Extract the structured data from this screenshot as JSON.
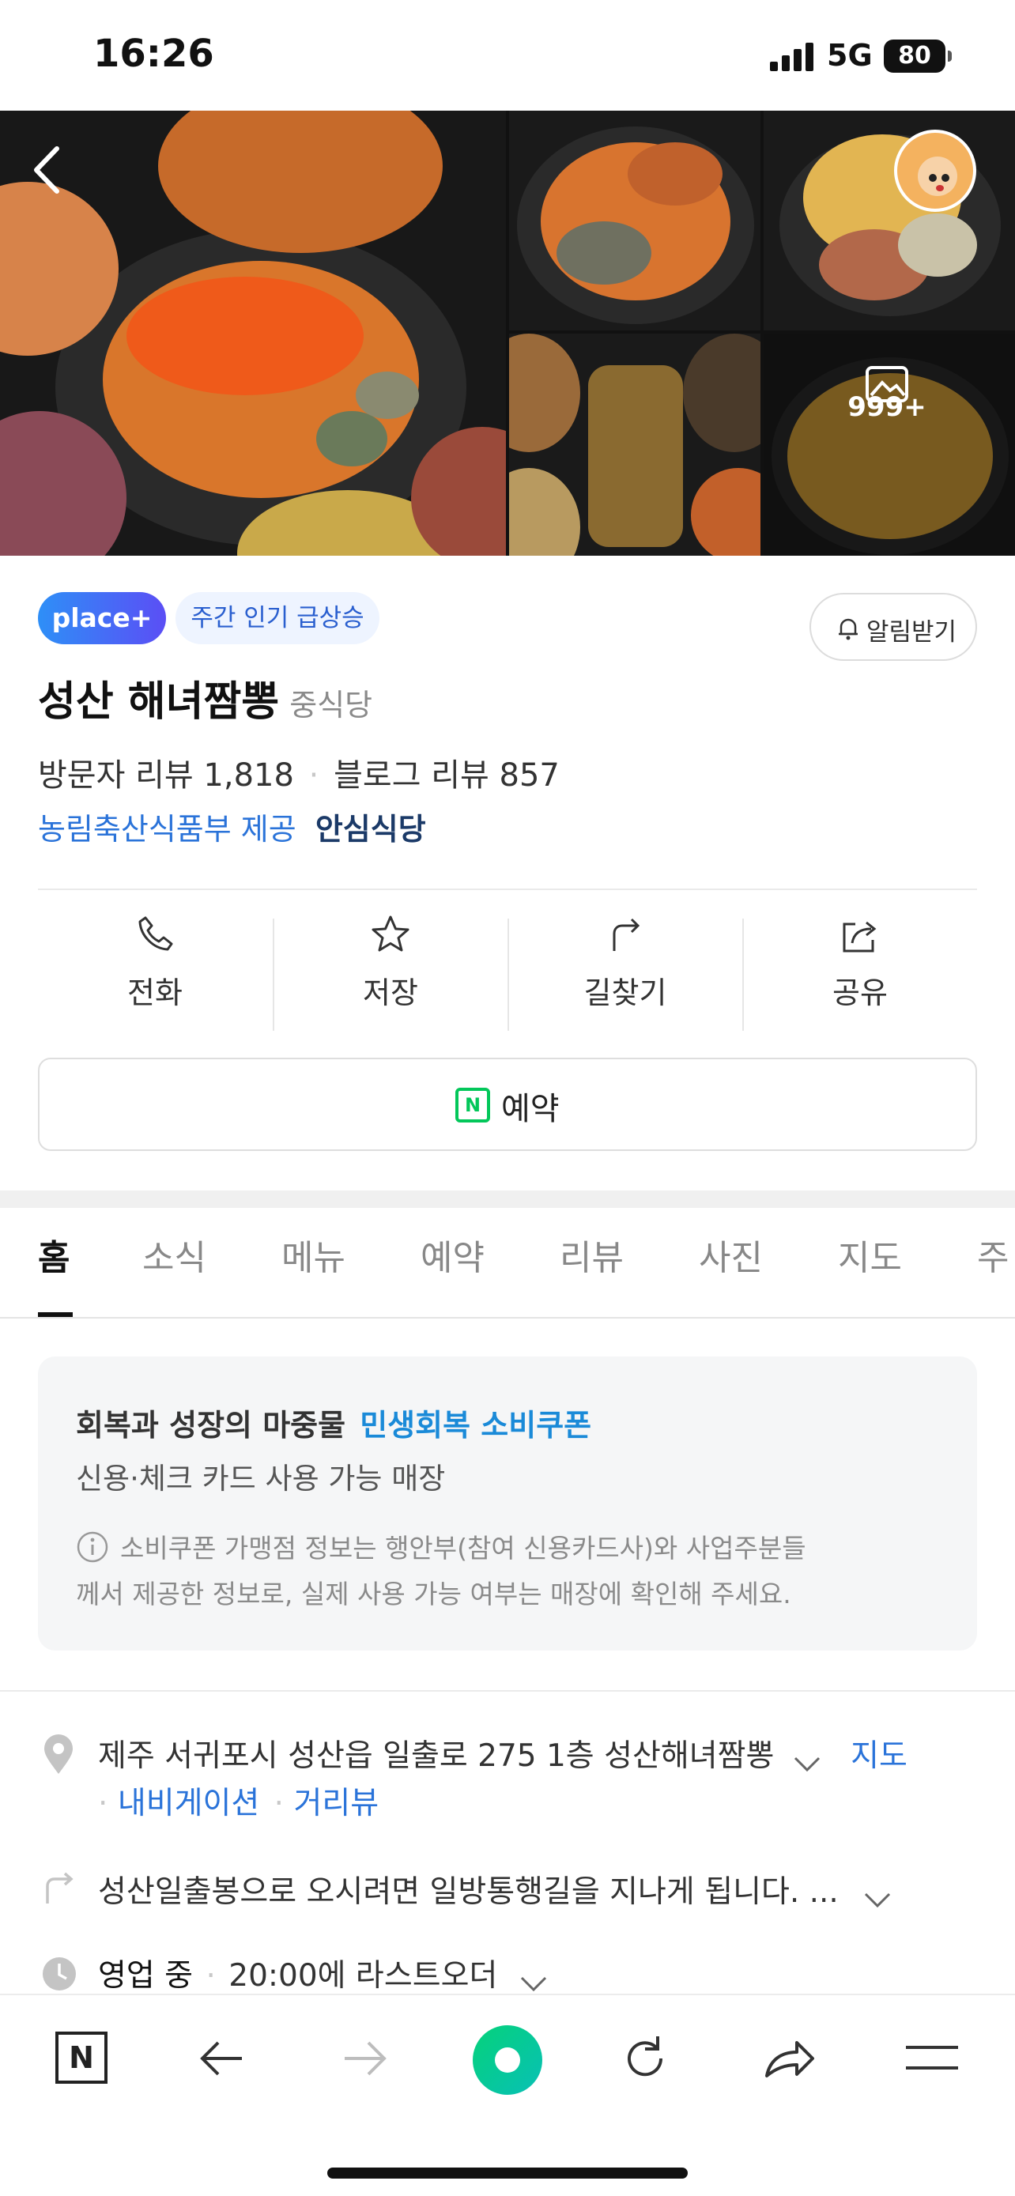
{
  "status": {
    "time": "16:26",
    "network": "5G",
    "battery": "80"
  },
  "gallery": {
    "photo_count": "999+"
  },
  "badges": {
    "place_plus": "place+",
    "trend": "주간 인기 급상승"
  },
  "notify_button": "알림받기",
  "place": {
    "name": "성산 해녀짬뽕",
    "category": "중식당"
  },
  "reviews": {
    "visitor": "방문자 리뷰 1,818",
    "blog": "블로그 리뷰 857"
  },
  "safe": {
    "provider": "농림축산식품부 제공",
    "label": "안심식당"
  },
  "actions": [
    {
      "label": "전화",
      "icon": "phone-icon"
    },
    {
      "label": "저장",
      "icon": "star-icon"
    },
    {
      "label": "길찾기",
      "icon": "directions-icon"
    },
    {
      "label": "공유",
      "icon": "share-icon"
    }
  ],
  "reserve_button": "예약",
  "tabs": [
    "홈",
    "소식",
    "메뉴",
    "예약",
    "리뷰",
    "사진",
    "지도",
    "주"
  ],
  "coupon": {
    "title_prefix": "회복과 성장의 마중물",
    "title_highlight": "민생회복 소비쿠폰",
    "subtitle": "신용·체크 카드 사용 가능 매장",
    "notice_line1": "소비쿠폰 가맹점 정보는 행안부(참여 신용카드사)와 사업주분들",
    "notice_line2": "께서 제공한 정보로, 실제 사용 가능 여부는 매장에 확인해 주세요."
  },
  "info": {
    "address": "제주 서귀포시 성산읍 일출로 275 1층 성산해녀짬뽕",
    "map_link": "지도",
    "navigation_link": "내비게이션",
    "street_view_link": "거리뷰",
    "directions_text": "성산일출봉으로 오시려면 일방통행길을 지나게 됩니다. ...",
    "hours_status": "영업 중",
    "hours_detail": "20:00에 라스트오더"
  },
  "colors": {
    "accent": "#2a73d9",
    "place_plus": "#3d6ef5",
    "brand_green": "#03c75a"
  }
}
